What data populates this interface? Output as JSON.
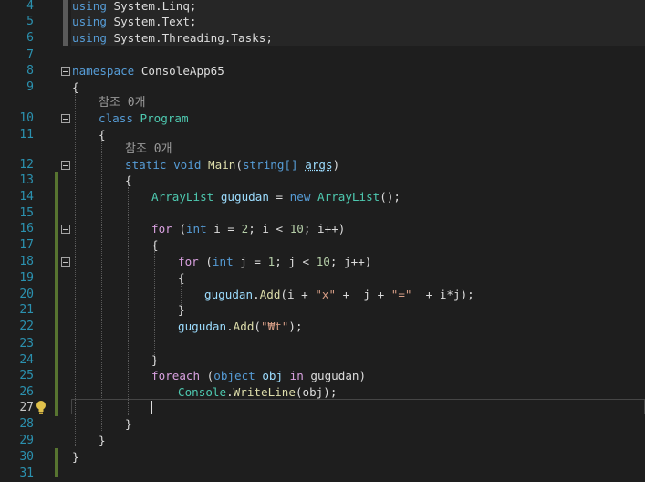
{
  "editor": {
    "using_lines": [
      {
        "num": "4",
        "kw": "using",
        "ns": "System.Linq;"
      },
      {
        "num": "5",
        "kw": "using",
        "ns": "System.Text;"
      },
      {
        "num": "6",
        "kw": "using",
        "ns": "System.Threading.Tasks;"
      }
    ],
    "blank_nums": [
      "7",
      "15",
      "23"
    ],
    "namespace": {
      "num": "8",
      "kw": "namespace",
      "name": "ConsoleApp65"
    },
    "open_brace_ns": {
      "num": "9",
      "text": "{"
    },
    "refs_class": "참조 0개",
    "class_decl": {
      "num": "10",
      "kw": "class",
      "name": "Program"
    },
    "open_brace_class": {
      "num": "11",
      "text": "{"
    },
    "refs_main": "참조 0개",
    "main_decl": {
      "num": "12",
      "kw1": "static",
      "kw2": "void",
      "name": "Main",
      "param_type": "string[]",
      "param_name": "args"
    },
    "open_brace_main": {
      "num": "13",
      "text": "{"
    },
    "line14": {
      "num": "14",
      "type": "ArrayList",
      "var": "gugudan",
      "op": " = ",
      "kw": "new",
      "ctor": "ArrayList",
      "tail": "();"
    },
    "line16": {
      "num": "16",
      "kw": "for",
      "p1": " (",
      "int": "int",
      "rest1": " i = ",
      "n1": "2",
      "rest2": "; i < ",
      "n2": "10",
      "rest3": "; i++)"
    },
    "line17": {
      "num": "17",
      "text": "{"
    },
    "line18": {
      "num": "18",
      "kw": "for",
      "p1": " (",
      "int": "int",
      "rest1": " j = ",
      "n1": "1",
      "rest2": "; j < ",
      "n2": "10",
      "rest3": "; j++)"
    },
    "line19": {
      "num": "19",
      "text": "{"
    },
    "line20": {
      "num": "20",
      "var": "gugudan",
      "dot": ".",
      "method": "Add",
      "a": "(i + ",
      "s1": "\"x\"",
      "b": " +  j + ",
      "s2": "\"=\"",
      "c": "  + i*j);"
    },
    "line21": {
      "num": "21",
      "text": "}"
    },
    "line22": {
      "num": "22",
      "var": "gugudan",
      "dot": ".",
      "method": "Add",
      "a": "(",
      "s1": "\"₩t\"",
      "c": ");"
    },
    "line24": {
      "num": "24",
      "text": "}"
    },
    "line25": {
      "num": "25",
      "kw": "foreach",
      "p": " (",
      "kw2": "object",
      "v": " obj ",
      "kw3": "in",
      "v2": " gugudan)"
    },
    "line26": {
      "num": "26",
      "type": "Console",
      "dot": ".",
      "method": "WriteLine",
      "tail": "(obj);"
    },
    "line27": {
      "num": "27"
    },
    "line28": {
      "num": "28",
      "text": "}"
    },
    "line29": {
      "num": "29",
      "text": "}"
    },
    "line30": {
      "num": "30",
      "text": "}"
    },
    "line31": {
      "num": "31"
    }
  },
  "colors": {
    "background": "#1e1e1e",
    "line_number": "#2b91af",
    "keyword": "#569cd6",
    "type": "#4ec9b0",
    "method": "#dcdcaa",
    "string": "#d69d85",
    "number": "#b5cea8",
    "change_bar": "#577430"
  },
  "icons": {
    "lightbulb": "lightbulb-icon",
    "fold": "collapse-icon"
  }
}
